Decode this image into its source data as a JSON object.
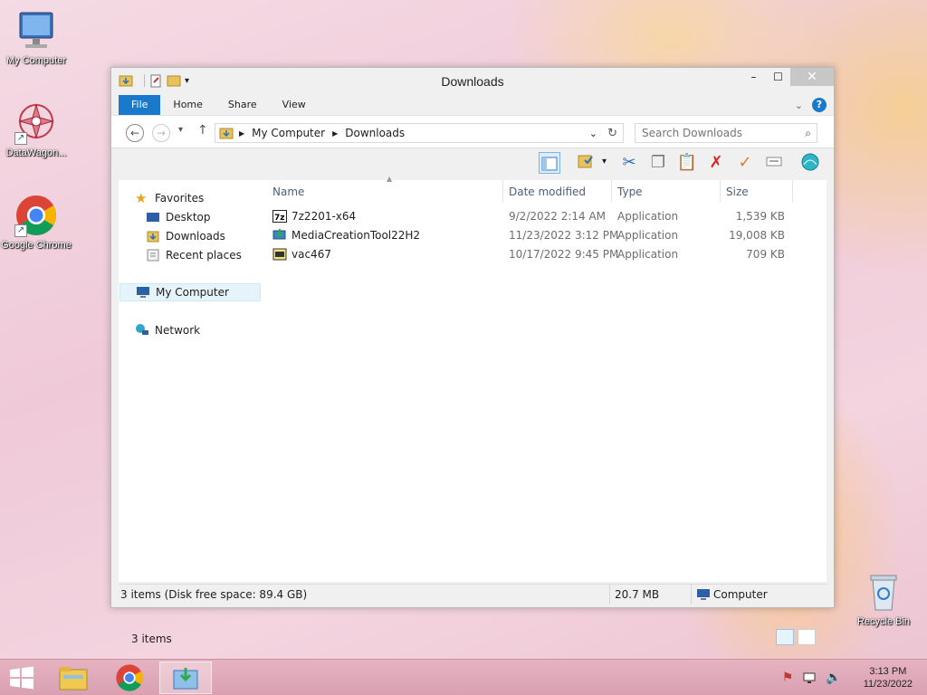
{
  "desktop": {
    "icons": [
      {
        "label": "My Computer"
      },
      {
        "label": "DataWagon..."
      },
      {
        "label": "Google Chrome"
      },
      {
        "label": "Recycle Bin"
      }
    ]
  },
  "window": {
    "title": "Downloads",
    "controls": {
      "minimize": "–",
      "maximize": "☐",
      "close": "✕"
    },
    "tabs": {
      "file": "File",
      "home": "Home",
      "share": "Share",
      "view": "View"
    },
    "help": "?"
  },
  "nav": {
    "breadcrumb": [
      "My Computer",
      "Downloads"
    ],
    "search_placeholder": "Search Downloads"
  },
  "navpane": {
    "favorites": "Favorites",
    "desktop": "Desktop",
    "downloads": "Downloads",
    "recent": "Recent places",
    "computer": "My Computer",
    "network": "Network"
  },
  "files": {
    "columns": {
      "name": "Name",
      "date": "Date modified",
      "type": "Type",
      "size": "Size"
    },
    "rows": [
      {
        "name": "7z2201-x64",
        "date": "9/2/2022 2:14 AM",
        "type": "Application",
        "size": "1,539 KB"
      },
      {
        "name": "MediaCreationTool22H2",
        "date": "11/23/2022 3:12 PM",
        "type": "Application",
        "size": "19,008 KB"
      },
      {
        "name": "vac467",
        "date": "10/17/2022 9:45 PM",
        "type": "Application",
        "size": "709 KB"
      }
    ],
    "item_count": "3 items"
  },
  "status": {
    "summary": "3 items (Disk free space: 89.4 GB)",
    "total_size": "20.7 MB",
    "location": "Computer"
  },
  "taskbar": {
    "time": "3:13 PM",
    "date": "11/23/2022"
  },
  "colors": {
    "accent": "#1979ca",
    "taskbar": "#dca5b6"
  }
}
